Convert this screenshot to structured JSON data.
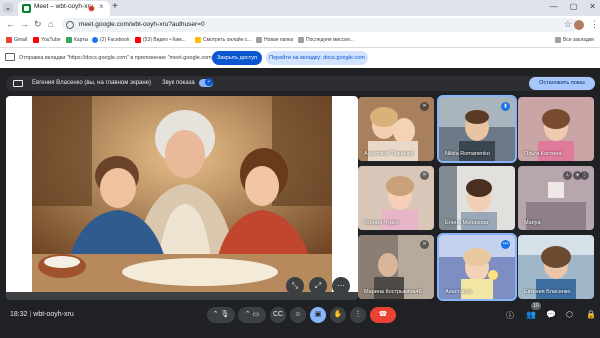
{
  "browser": {
    "tab_title": "Meet – wbt-ooyh-xru",
    "new_tab_glyph": "+",
    "url": "meet.google.com/wbt-ooyh-xru?authuser=0",
    "bookmarks": [
      "Gmail",
      "YouTube",
      "Карты",
      "(2) Facebook",
      "(53) Видео • Ким...",
      "Смотреть онлайн с...",
      "Новая папка",
      "Последняя миссия..."
    ],
    "all_bookmarks": "Все закладки"
  },
  "infobar": {
    "text": "Отправка вкладки \"https://docs.google.com\" в приложение \"meet.google.com/wbt-ooyh-xru\".",
    "share_button": "Закрыть доступ",
    "goto_button": "Перейти на вкладку: docs.google.com"
  },
  "presenting": {
    "presenter": "Евгения Власенко (вы, на главном экране)",
    "sound_label": "Звук показа",
    "sound_on": true,
    "stop_button": "Остановить показ"
  },
  "participants": [
    {
      "name": "Анастасія Ткаченко",
      "mic": "muted"
    },
    {
      "name": "Nikita Romanenko",
      "mic": "speaking"
    },
    {
      "name": "Ольга Костина",
      "mic": "none"
    },
    {
      "name": "Ксения Чуйко",
      "mic": "muted"
    },
    {
      "name": "Елена Монахова",
      "mic": "none"
    },
    {
      "name": "Мariya",
      "mic": "none"
    },
    {
      "name": "Марина Кострыкина46",
      "mic": "muted"
    },
    {
      "name": "Анастасия",
      "mic": "speaking"
    },
    {
      "name": "Евгения Власенко",
      "mic": "none"
    }
  ],
  "bottom": {
    "time": "18:32",
    "separator": "|",
    "meeting_code": "wbt-ooyh-xru",
    "people_count": "10"
  },
  "colors": {
    "meet_bg": "#202124",
    "end_call": "#ea4335",
    "accent": "#0b57d0"
  }
}
